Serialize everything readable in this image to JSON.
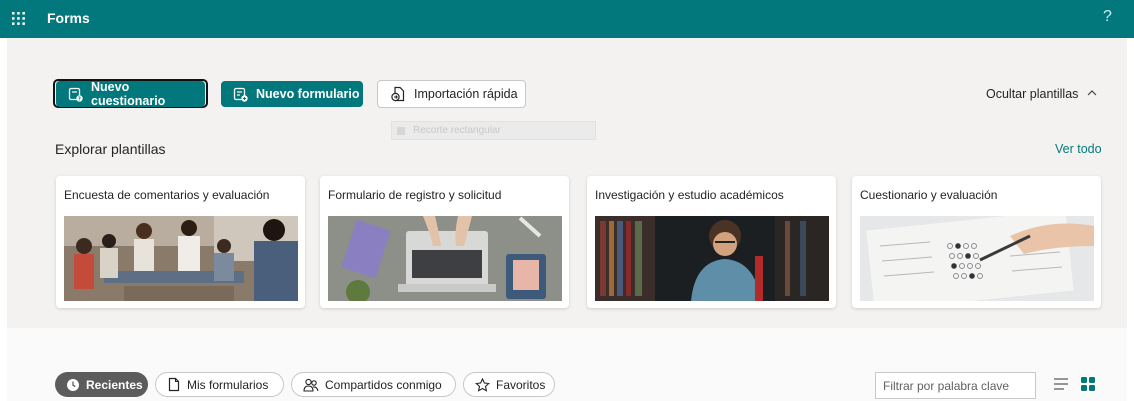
{
  "header": {
    "app_title": "Forms",
    "help_label": "?"
  },
  "actions": {
    "new_quiz": "Nuevo cuestionario",
    "new_form": "Nuevo formulario",
    "quick_import": "Importación rápida",
    "hide_templates": "Ocultar plantillas"
  },
  "overlay": {
    "snip_label": "Recorte rectangular"
  },
  "templates": {
    "title": "Explorar plantillas",
    "see_all": "Ver todo",
    "cards": [
      {
        "title": "Encuesta de comentarios y evaluación"
      },
      {
        "title": "Formulario de registro y solicitud"
      },
      {
        "title": "Investigación y estudio académicos"
      },
      {
        "title": "Cuestionario y evaluación"
      }
    ]
  },
  "filters": {
    "recent": "Recientes",
    "my_forms": "Mis formularios",
    "shared": "Compartidos conmigo",
    "favorites": "Favoritos"
  },
  "search": {
    "placeholder": "Filtrar por palabra clave",
    "value": ""
  },
  "colors": {
    "brand": "#03787c",
    "active_pill": "#5c5c5c",
    "link": "#03787c"
  },
  "icons": [
    "app-launcher-icon",
    "help-icon",
    "quiz-icon",
    "form-icon",
    "import-icon",
    "chevron-up-icon",
    "clock-icon",
    "document-icon",
    "people-icon",
    "star-icon",
    "list-view-icon",
    "grid-view-icon"
  ]
}
